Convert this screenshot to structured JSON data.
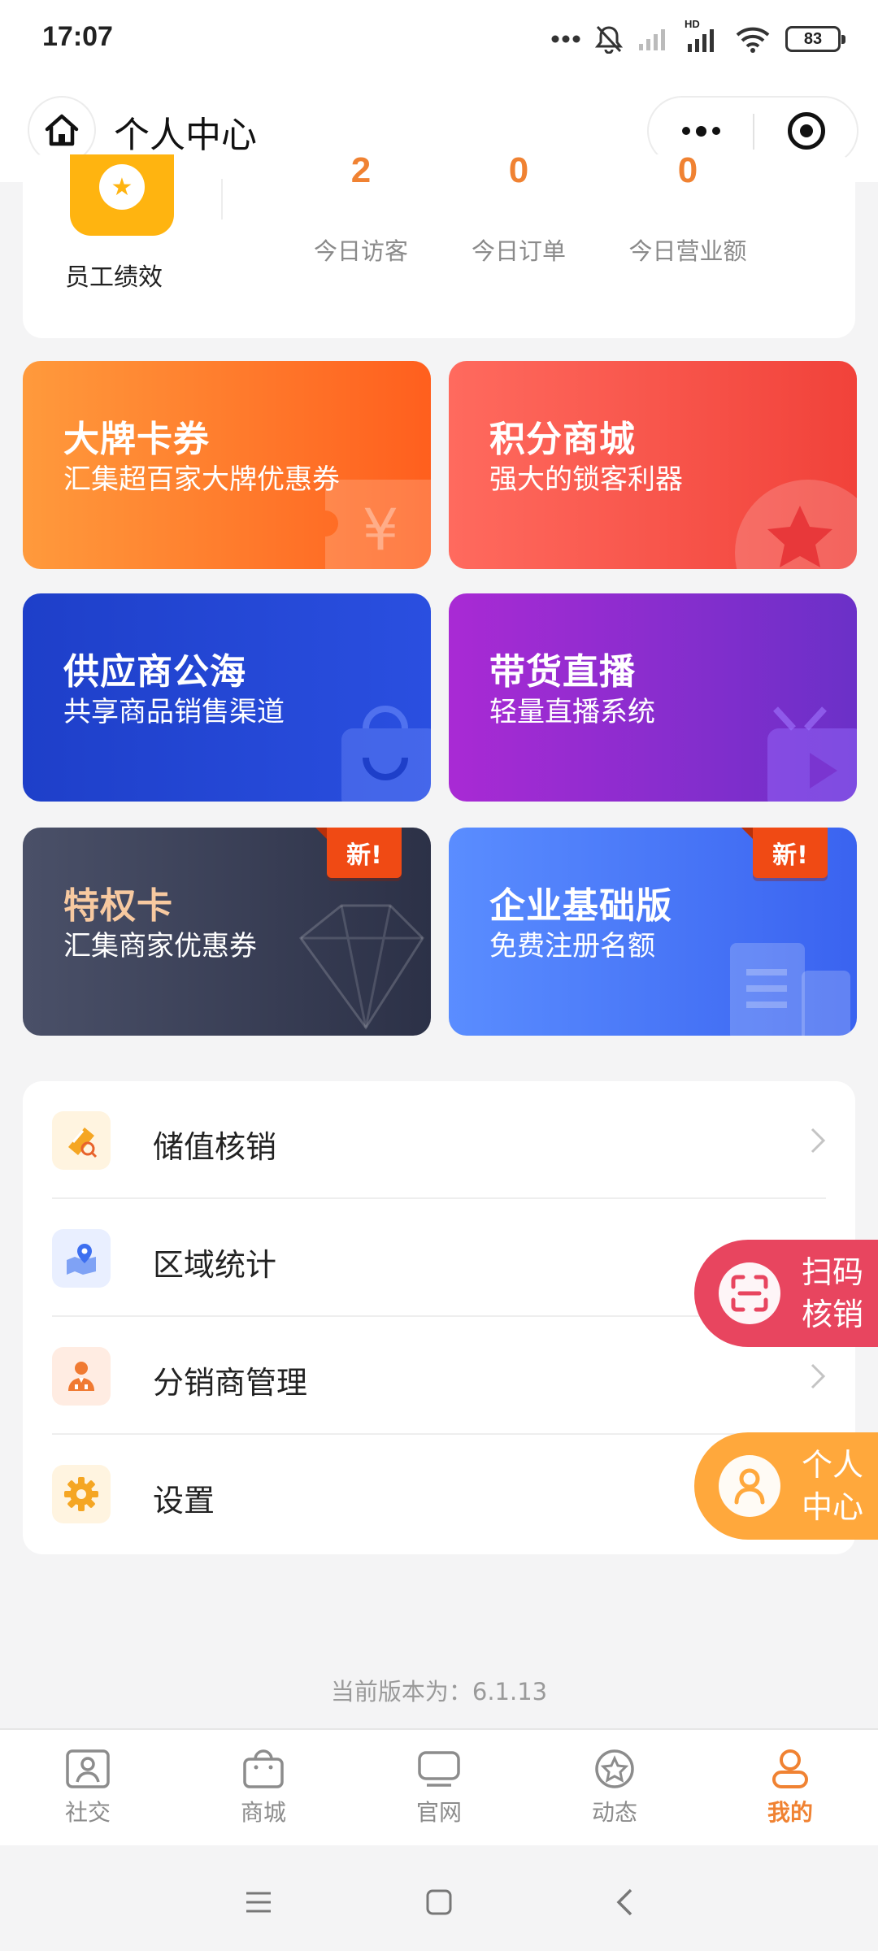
{
  "status_bar": {
    "time": "17:07",
    "battery": "83",
    "network_label": "HD",
    "icons": [
      "more-dots-icon",
      "bell-muted-icon",
      "signal-icon",
      "hd-signal-icon",
      "wifi-icon",
      "battery-icon"
    ]
  },
  "header": {
    "title": "个人中心",
    "home_icon": "home-icon",
    "more_icon": "more-dots-icon",
    "close_icon": "target-icon"
  },
  "stats": {
    "performance_label": "员工绩效",
    "items": [
      {
        "value": "2",
        "label": "今日访客"
      },
      {
        "value": "0",
        "label": "今日订单"
      },
      {
        "value": "0",
        "label": "今日营业额"
      }
    ]
  },
  "features": [
    {
      "title": "大牌卡券",
      "subtitle": "汇集超百家大牌优惠券",
      "badge": "",
      "colors": [
        "#ff9a3c",
        "#ff5f1e"
      ]
    },
    {
      "title": "积分商城",
      "subtitle": "强大的锁客利器",
      "badge": "",
      "colors": [
        "#ff6a5e",
        "#f1423a"
      ]
    },
    {
      "title": "供应商公海",
      "subtitle": "共享商品销售渠道",
      "badge": "",
      "colors": [
        "#1e3fc9",
        "#2a4fe0"
      ]
    },
    {
      "title": "带货直播",
      "subtitle": "轻量直播系统",
      "badge": "",
      "colors": [
        "#a92ad4",
        "#6b30c8"
      ]
    },
    {
      "title": "特权卡",
      "subtitle": "汇集商家优惠券",
      "badge": "新!",
      "colors": [
        "#4a5068",
        "#2c3147"
      ]
    },
    {
      "title": "企业基础版",
      "subtitle": "免费注册名额",
      "badge": "新!",
      "colors": [
        "#5a8dff",
        "#3a63f0"
      ]
    }
  ],
  "menu": [
    {
      "label": "储值核销",
      "icon": "stored-value-icon",
      "icon_color": "#f5a623",
      "icon_bg": "#fff4e0"
    },
    {
      "label": "区域统计",
      "icon": "map-pin-icon",
      "icon_color": "#4a7cf0",
      "icon_bg": "#e9efff"
    },
    {
      "label": "分销商管理",
      "icon": "distributor-icon",
      "icon_color": "#f07a32",
      "icon_bg": "#ffece2"
    },
    {
      "label": "设置",
      "icon": "gear-icon",
      "icon_color": "#f5a623",
      "icon_bg": "#fff4e0"
    }
  ],
  "floating": {
    "scan": {
      "line1": "扫码",
      "line2": "核销",
      "color": "#e8455f"
    },
    "profile": {
      "line1": "个人",
      "line2": "中心",
      "color": "#ffa83c"
    }
  },
  "version_text": "当前版本为：6.1.13",
  "tabs": [
    {
      "label": "社交",
      "icon": "social-icon",
      "active": false
    },
    {
      "label": "商城",
      "icon": "shopping-bag-icon",
      "active": false
    },
    {
      "label": "官网",
      "icon": "monitor-icon",
      "active": false
    },
    {
      "label": "动态",
      "icon": "star-circle-icon",
      "active": false
    },
    {
      "label": "我的",
      "icon": "user-icon",
      "active": true
    }
  ],
  "accent_color": "#f08232"
}
